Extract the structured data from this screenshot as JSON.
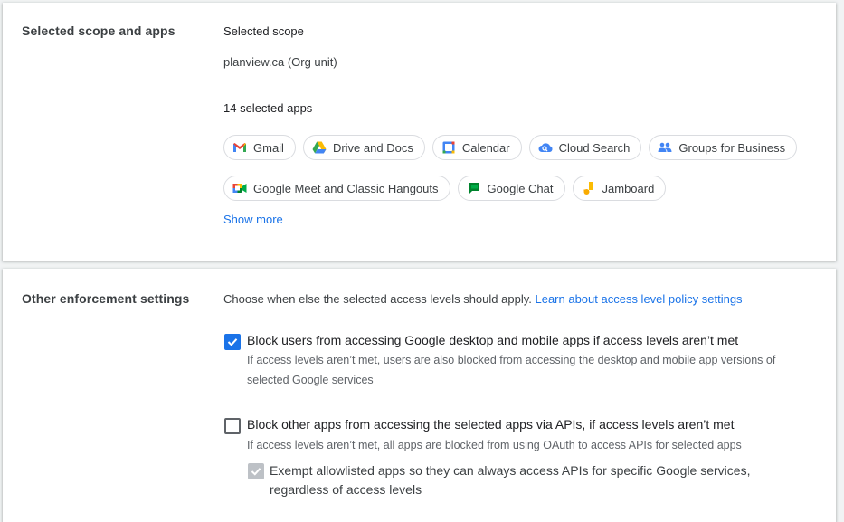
{
  "scope_section": {
    "title": "Selected scope and apps",
    "scope_label": "Selected scope",
    "scope_value": "planview.ca (Org unit)",
    "apps_count": "14 selected apps",
    "apps_row1": [
      {
        "label": "Gmail",
        "icon": "gmail-icon"
      },
      {
        "label": "Drive and Docs",
        "icon": "drive-icon"
      },
      {
        "label": "Calendar",
        "icon": "calendar-icon"
      },
      {
        "label": "Cloud Search",
        "icon": "cloud-search-icon"
      },
      {
        "label": "Groups for Business",
        "icon": "groups-icon"
      }
    ],
    "apps_row2": [
      {
        "label": "Google Meet and Classic Hangouts",
        "icon": "meet-icon"
      },
      {
        "label": "Google Chat",
        "icon": "chat-icon"
      },
      {
        "label": "Jamboard",
        "icon": "jamboard-icon"
      }
    ],
    "show_more": "Show more"
  },
  "enforcement_section": {
    "title": "Other enforcement settings",
    "intro": "Choose when else the selected access levels should apply.",
    "intro_link": "Learn about access level policy settings",
    "options": [
      {
        "label": "Block users from accessing Google desktop and mobile apps if access levels aren’t met",
        "desc_line1": "If access levels aren’t met, users are also blocked from accessing the desktop and mobile app versions of",
        "desc_line2": "selected Google services",
        "checked": true
      },
      {
        "label": "Block other apps from accessing the selected apps via APIs, if access levels aren’t met",
        "desc_line1": "If access levels aren’t met, all apps are blocked from using OAuth to access APIs for selected apps",
        "checked": false
      }
    ],
    "sub_option": {
      "label_line1": "Exempt allowlisted apps so they can always access APIs for specific Google services,",
      "label_line2": "regardless of access levels",
      "checked": true,
      "disabled": true
    }
  },
  "colors": {
    "accent": "#1a73e8",
    "disabled": "#bdc1c6"
  }
}
